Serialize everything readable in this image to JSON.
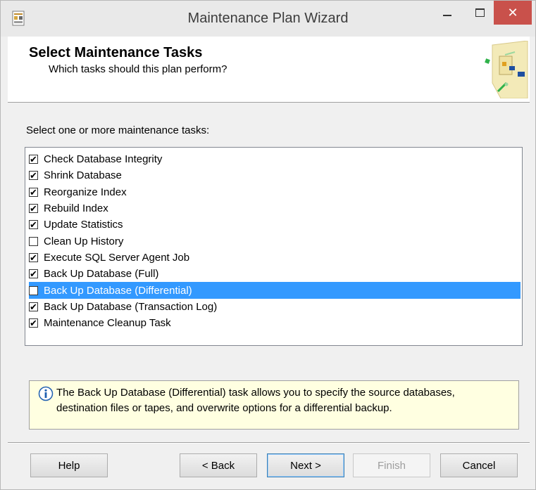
{
  "window": {
    "title": "Maintenance Plan Wizard",
    "close_glyph": "✕"
  },
  "header": {
    "title": "Select Maintenance Tasks",
    "subtitle": "Which tasks should this plan perform?"
  },
  "prompt": "Select one or more maintenance tasks:",
  "tasks": [
    {
      "label": "Check Database Integrity",
      "checked": true,
      "selected": false
    },
    {
      "label": "Shrink Database",
      "checked": true,
      "selected": false
    },
    {
      "label": "Reorganize Index",
      "checked": true,
      "selected": false
    },
    {
      "label": "Rebuild Index",
      "checked": true,
      "selected": false
    },
    {
      "label": "Update Statistics",
      "checked": true,
      "selected": false
    },
    {
      "label": "Clean Up History",
      "checked": false,
      "selected": false
    },
    {
      "label": "Execute SQL Server Agent Job",
      "checked": true,
      "selected": false
    },
    {
      "label": "Back Up Database (Full)",
      "checked": true,
      "selected": false
    },
    {
      "label": "Back Up Database (Differential)",
      "checked": false,
      "selected": true
    },
    {
      "label": "Back Up Database (Transaction Log)",
      "checked": true,
      "selected": false
    },
    {
      "label": "Maintenance Cleanup Task",
      "checked": true,
      "selected": false
    }
  ],
  "check_glyph": "✔",
  "description": "The Back Up Database (Differential) task allows you to specify the source databases, destination files or tapes, and overwrite options for a differential backup.",
  "buttons": {
    "help": "Help",
    "back": "< Back",
    "next": "Next >",
    "finish": "Finish",
    "cancel": "Cancel"
  },
  "icons": {
    "app": "wizard-app-icon",
    "header": "maintenance-plan-graphic",
    "info": "info-icon"
  },
  "colors": {
    "selection": "#3399ff",
    "close_button": "#c9514b",
    "description_bg": "#ffffe1"
  }
}
